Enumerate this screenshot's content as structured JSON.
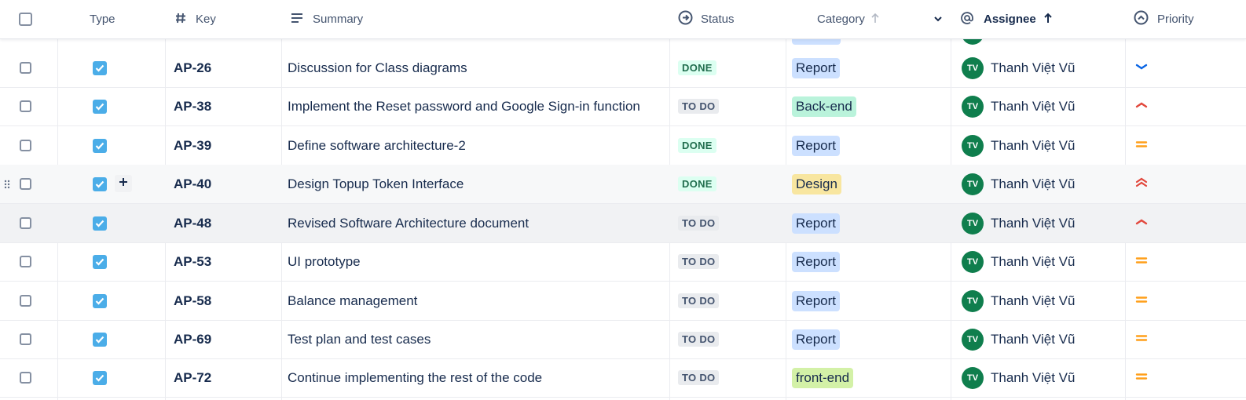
{
  "header": {
    "type_label": "Type",
    "key_label": "Key",
    "summary_label": "Summary",
    "status_label": "Status",
    "category_label": "Category",
    "assignee_label": "Assignee",
    "priority_label": "Priority"
  },
  "colors": {
    "done_bg": "#dcfff1",
    "done_fg": "#216e4e",
    "todo_bg": "#e9ebee",
    "todo_fg": "#44546f",
    "report_bg": "#cce0ff",
    "backend_bg": "#baf3db",
    "design_bg": "#f8e6a0",
    "frontend_bg": "#d3f1a7",
    "avatar": "#0f7e4d",
    "type_check": "#4bade8",
    "priority_low": "#0c66e4",
    "priority_high": "#e2483d",
    "priority_medium": "#ff9f1a"
  },
  "rows": [
    {
      "key": "AP-26",
      "summary": "Discussion for Class diagrams",
      "status": "DONE",
      "category": "Report",
      "assignee_initials": "TV",
      "assignee": "Thanh Việt Vũ",
      "priority_icon": "priority-low-icon"
    },
    {
      "key": "AP-38",
      "summary": "Implement the Reset password and Google Sign-in function",
      "status": "TO DO",
      "category": "Back-end",
      "assignee_initials": "TV",
      "assignee": "Thanh Việt Vũ",
      "priority_icon": "priority-high-icon"
    },
    {
      "key": "AP-39",
      "summary": "Define software architecture-2",
      "status": "DONE",
      "category": "Report",
      "assignee_initials": "TV",
      "assignee": "Thanh Việt Vũ",
      "priority_icon": "priority-medium-icon"
    },
    {
      "key": "AP-40",
      "summary": "Design Topup Token Interface",
      "status": "DONE",
      "category": "Design",
      "assignee_initials": "TV",
      "assignee": "Thanh Việt Vũ",
      "priority_icon": "priority-highest-icon"
    },
    {
      "key": "AP-48",
      "summary": "Revised Software Architecture document",
      "status": "TO DO",
      "category": "Report",
      "assignee_initials": "TV",
      "assignee": "Thanh Việt Vũ",
      "priority_icon": "priority-high-icon"
    },
    {
      "key": "AP-53",
      "summary": "UI prototype",
      "status": "TO DO",
      "category": "Report",
      "assignee_initials": "TV",
      "assignee": "Thanh Việt Vũ",
      "priority_icon": "priority-medium-icon"
    },
    {
      "key": "AP-58",
      "summary": "Balance management",
      "status": "TO DO",
      "category": "Report",
      "assignee_initials": "TV",
      "assignee": "Thanh Việt Vũ",
      "priority_icon": "priority-medium-icon"
    },
    {
      "key": "AP-69",
      "summary": "Test plan and test cases",
      "status": "TO DO",
      "category": "Report",
      "assignee_initials": "TV",
      "assignee": "Thanh Việt Vũ",
      "priority_icon": "priority-medium-icon"
    },
    {
      "key": "AP-72",
      "summary": "Continue implementing the rest of the code",
      "status": "TO DO",
      "category": "front-end",
      "assignee_initials": "TV",
      "assignee": "Thanh Việt Vũ",
      "priority_icon": "priority-medium-icon"
    }
  ]
}
